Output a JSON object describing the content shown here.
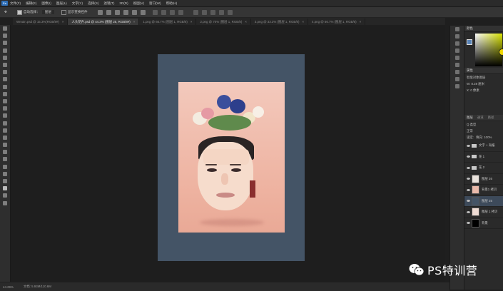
{
  "menu": {
    "app_logo": "Ps",
    "items": [
      "文件(F)",
      "编辑(E)",
      "图像(I)",
      "图层(L)",
      "文字(Y)",
      "选择(S)",
      "滤镜(T)",
      "3D(D)",
      "视图(V)",
      "窗口(W)",
      "帮助(H)"
    ]
  },
  "options": {
    "auto_select_label": "自动选择：",
    "auto_select_value": "图层",
    "show_transform_label": "显示变换控件"
  },
  "tabs": [
    {
      "label": "Wmain.psd @ 15.3%(RGB/8#)",
      "active": false
    },
    {
      "label": "人头花卉.psd @ 44.3% (图层 25, RGB/8#)",
      "active": true
    },
    {
      "label": "1.png @ 66.7% (图层 1, RGB/8)",
      "active": false
    },
    {
      "label": "2.png @ 70% (图层 1, RGB/8)",
      "active": false
    },
    {
      "label": "3.png @ 33.3% (图层 1, RGB/8)",
      "active": false
    },
    {
      "label": "4.png @ 66.7% (图层 1, RGB/8)",
      "active": false
    }
  ],
  "panels": {
    "color_header": "颜色",
    "properties_header": "属性",
    "properties_title": "智能对象图层",
    "properties_w": "W: 8.28 厘米",
    "properties_x": "X: 0 像素",
    "layers_header": "图层",
    "channels_header": "通道",
    "paths_header": "路径",
    "kind_label": "Q 类型",
    "blend_mode": "正常",
    "lock_label": "锁定:",
    "fill_label": "填充: 100%",
    "layers": [
      {
        "name": "文字 + 海报",
        "type": "group",
        "selected": false
      },
      {
        "name": "花 1",
        "type": "group",
        "selected": false
      },
      {
        "name": "花 2",
        "type": "group",
        "selected": false
      },
      {
        "name": "图层 26",
        "type": "pixel",
        "selected": false
      },
      {
        "name": "背景1 拷贝",
        "type": "pixel",
        "selected": false
      },
      {
        "name": "图层 25",
        "type": "smart",
        "selected": true
      },
      {
        "name": "图层 1 拷贝",
        "type": "pixel",
        "selected": false
      },
      {
        "name": "背景",
        "type": "fill",
        "selected": false
      }
    ]
  },
  "status": {
    "zoom": "44.29%",
    "doc": "文档: 5.93M/110.6M"
  },
  "watermark": {
    "text": "PS特训营"
  },
  "colors": {
    "canvas_bg": "#445466",
    "photo_top": "#f3c9bc",
    "photo_bottom": "#e9a996",
    "selected_layer": "#3d4a5a"
  }
}
